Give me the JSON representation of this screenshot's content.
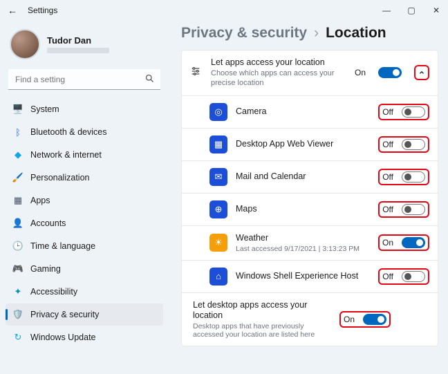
{
  "window": {
    "title": "Settings"
  },
  "user": {
    "name": "Tudor Dan"
  },
  "search": {
    "placeholder": "Find a setting"
  },
  "sidebar": {
    "items": [
      {
        "label": "System",
        "icon": "🖥️",
        "color": "#3b82f6"
      },
      {
        "label": "Bluetooth & devices",
        "icon": "ᛒ",
        "color": "#2563eb"
      },
      {
        "label": "Network & internet",
        "icon": "◆",
        "color": "#0ea5e9"
      },
      {
        "label": "Personalization",
        "icon": "🖌️",
        "color": "#f59e0b"
      },
      {
        "label": "Apps",
        "icon": "▦",
        "color": "#475569"
      },
      {
        "label": "Accounts",
        "icon": "👤",
        "color": "#64748b"
      },
      {
        "label": "Time & language",
        "icon": "🕒",
        "color": "#475569"
      },
      {
        "label": "Gaming",
        "icon": "🎮",
        "color": "#475569"
      },
      {
        "label": "Accessibility",
        "icon": "✦",
        "color": "#0891b2"
      },
      {
        "label": "Privacy & security",
        "icon": "🛡️",
        "color": "#64748b",
        "selected": true
      },
      {
        "label": "Windows Update",
        "icon": "↻",
        "color": "#0ea5e9"
      }
    ]
  },
  "breadcrumb": {
    "parent": "Privacy & security",
    "leaf": "Location",
    "sep": "›"
  },
  "section": {
    "title": "Let apps access your location",
    "subtitle": "Choose which apps can access your precise location",
    "state_label": "On",
    "on": true
  },
  "apps": [
    {
      "name": "Camera",
      "state": "Off",
      "on": false,
      "bg": "#1d4ed8",
      "glyph": "◎"
    },
    {
      "name": "Desktop App Web Viewer",
      "state": "Off",
      "on": false,
      "bg": "#1d4ed8",
      "glyph": "▦"
    },
    {
      "name": "Mail and Calendar",
      "state": "Off",
      "on": false,
      "bg": "#1d4ed8",
      "glyph": "✉"
    },
    {
      "name": "Maps",
      "state": "Off",
      "on": false,
      "bg": "#1d4ed8",
      "glyph": "⊕"
    },
    {
      "name": "Weather",
      "sub": "Last accessed 9/17/2021 | 3:13:23 PM",
      "state": "On",
      "on": true,
      "bg": "#f59e0b",
      "glyph": "☀"
    },
    {
      "name": "Windows Shell Experience Host",
      "state": "Off",
      "on": false,
      "bg": "#1d4ed8",
      "glyph": "⌂"
    }
  ],
  "footer": {
    "title": "Let desktop apps access your location",
    "subtitle": "Desktop apps that have previously accessed your location are listed here",
    "state_label": "On",
    "on": true
  }
}
